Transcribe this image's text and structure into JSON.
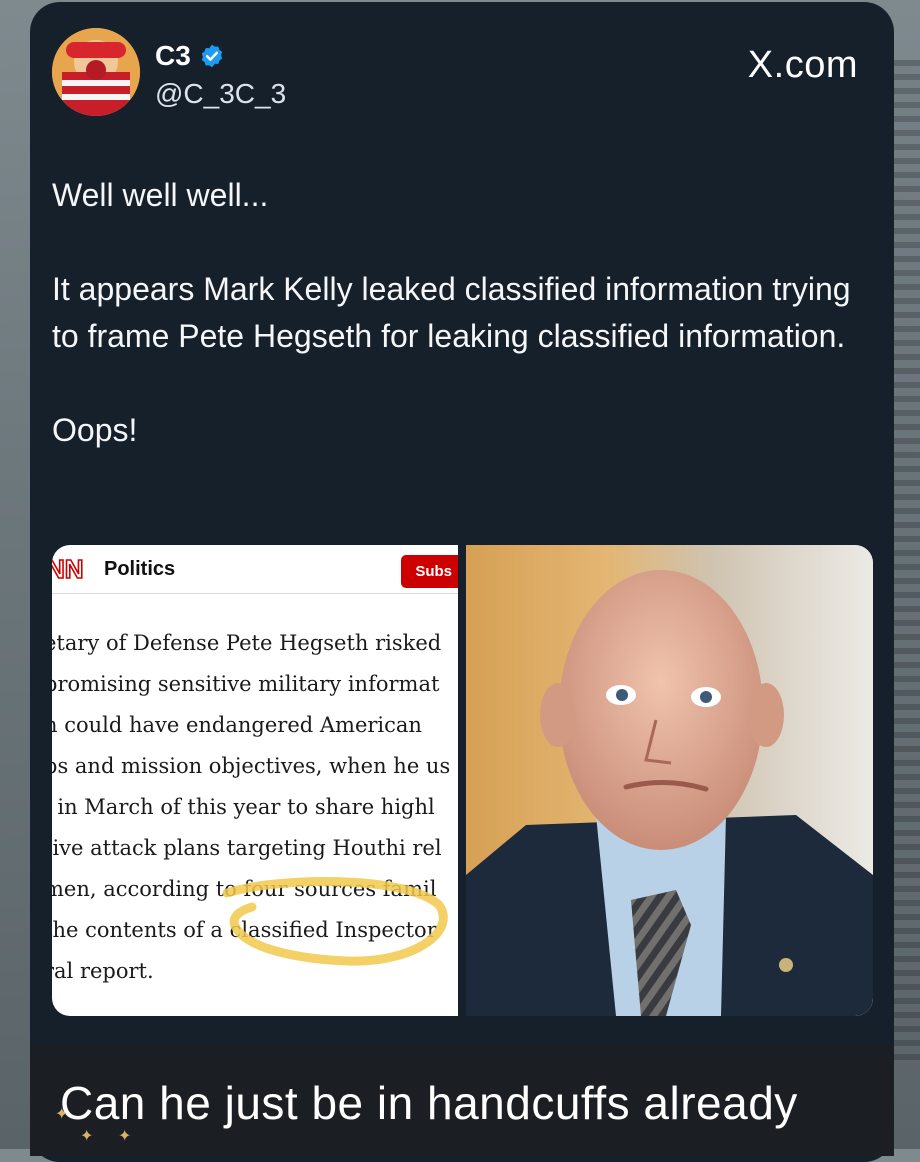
{
  "tweet": {
    "display_name": "C3",
    "handle": "@C_3C_3",
    "brand": "X.com",
    "text_lines": [
      "Well well well...",
      "It appears Mark Kelly leaked classified information trying to frame Pete Hegseth for leaking classified information.",
      "Oops!"
    ]
  },
  "article": {
    "section": "Politics",
    "subscribe_label": "Subs",
    "lines": [
      "etary of Defense Pete Hegseth risked",
      "promising sensitive military informat",
      "h could have endangered American",
      "ps and mission objectives, when he us",
      "l in March of this year to share highl",
      "tive attack plans targeting Houthi rel",
      "men, according to four sources famil",
      "the contents of a classified Inspector",
      "ral report."
    ]
  },
  "caption": "Can he just be in handcuffs already",
  "colors": {
    "card_bg": "#16202b",
    "verified": "#1d9bf0",
    "cnn_red": "#cc0000",
    "highlight": "#f2c94c"
  }
}
